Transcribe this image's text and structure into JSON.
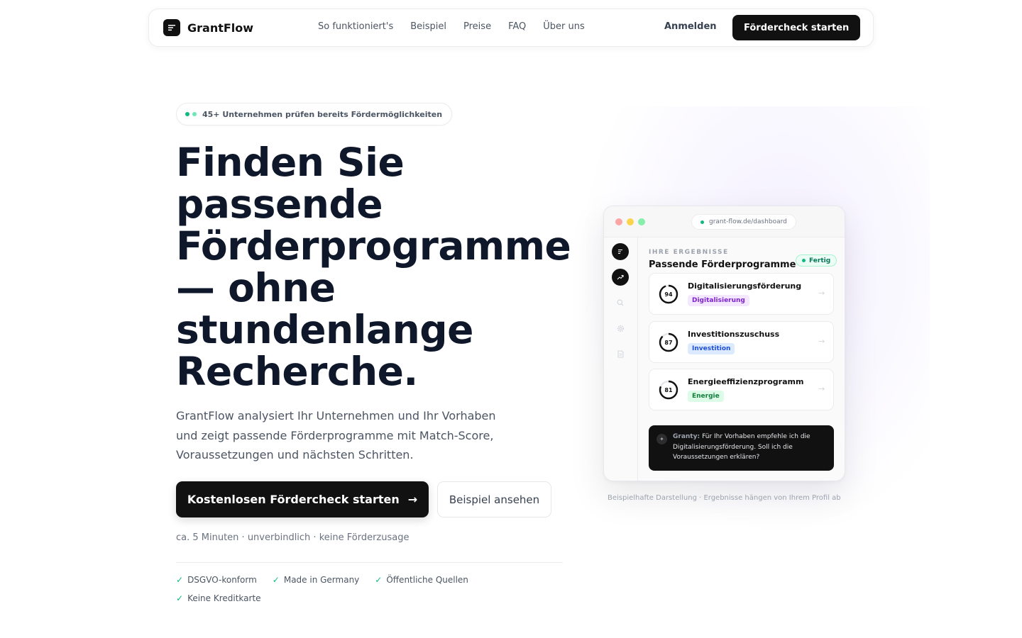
{
  "nav": {
    "brand": "GrantFlow",
    "links": [
      "So funktioniert's",
      "Beispiel",
      "Preise",
      "FAQ",
      "Über uns"
    ],
    "login": "Anmelden",
    "cta": "Fördercheck starten"
  },
  "hero": {
    "pill": "45+ Unternehmen prüfen bereits Fördermöglichkeiten",
    "headline_lines": [
      "Finden Sie",
      "passende",
      "Förderprogramme",
      "— ohne",
      "stundenlange",
      "Recherche."
    ],
    "subtitle": "GrantFlow analysiert Ihr Unternehmen und Ihr Vorhaben und zeigt passende Förderprogramme mit Match-Score, Voraussetzungen und nächsten Schritten.",
    "primary_cta": "Kostenlosen Fördercheck starten",
    "secondary_cta": "Beispiel ansehen",
    "meta": "ca. 5 Minuten · unverbindlich · keine Förderzusage",
    "trust": [
      "DSGVO-konform",
      "Made in Germany",
      "Öffentliche Quellen",
      "Keine Kreditkarte"
    ]
  },
  "mockup": {
    "url": "grant-flow.de/dashboard",
    "results_label": "IHRE ERGEBNISSE",
    "results_title": "Passende Förderprogramme",
    "status": "Fertig",
    "cards": [
      {
        "score": 94,
        "title": "Digitalisierungsförderung",
        "tag": "Digitalisierung",
        "tag_bg": "#f3e8ff",
        "tag_color": "#7e22ce"
      },
      {
        "score": 87,
        "title": "Investitionszuschuss",
        "tag": "Investition",
        "tag_bg": "#dbeafe",
        "tag_color": "#1d4ed8"
      },
      {
        "score": 81,
        "title": "Energieeffizienzprogramm",
        "tag": "Energie",
        "tag_bg": "#dcfce7",
        "tag_color": "#15803d"
      }
    ],
    "chat_name": "Granty:",
    "chat_text": "Für Ihr Vorhaben empfehle ich die Digitalisierungsförderung. Soll ich die Voraussetzungen erklären?",
    "caption": "Beispielhafte Darstellung · Ergebnisse hängen von Ihrem Profil ab"
  },
  "colors": {
    "accent_green": "#10b981",
    "dark": "#111111"
  }
}
